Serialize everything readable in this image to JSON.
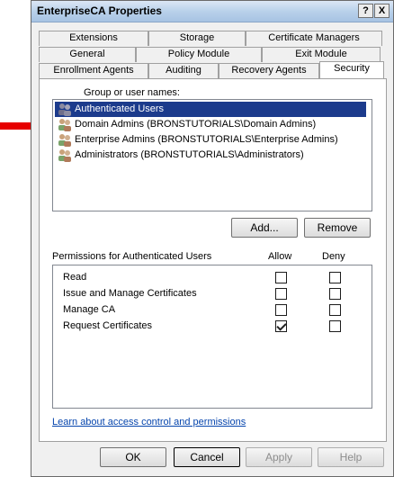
{
  "window": {
    "title": "EnterpriseCA Properties",
    "help_glyph": "?",
    "close_glyph": "X"
  },
  "tabs": {
    "row1": [
      "Extensions",
      "Storage",
      "Certificate Managers"
    ],
    "row2": [
      "General",
      "Policy Module",
      "Exit Module"
    ],
    "row3": [
      "Enrollment Agents",
      "Auditing",
      "Recovery Agents",
      "Security"
    ],
    "active": "Security"
  },
  "security": {
    "group_label": "Group or user names:",
    "users": [
      {
        "name": "Authenticated Users",
        "icon": "users-icon",
        "selected": true
      },
      {
        "name": "Domain Admins (BRONSTUTORIALS\\Domain Admins)",
        "icon": "users-icon",
        "selected": false
      },
      {
        "name": "Enterprise Admins (BRONSTUTORIALS\\Enterprise Admins)",
        "icon": "users-icon",
        "selected": false
      },
      {
        "name": "Administrators (BRONSTUTORIALS\\Administrators)",
        "icon": "users-icon",
        "selected": false
      }
    ],
    "add_label": "Add...",
    "remove_label": "Remove",
    "permissions_label": "Permissions for Authenticated Users",
    "allow_label": "Allow",
    "deny_label": "Deny",
    "permissions": [
      {
        "name": "Read",
        "allow": false,
        "deny": false
      },
      {
        "name": "Issue and Manage Certificates",
        "allow": false,
        "deny": false
      },
      {
        "name": "Manage CA",
        "allow": false,
        "deny": false
      },
      {
        "name": "Request Certificates",
        "allow": true,
        "deny": false
      }
    ],
    "link_text": "Learn about access control and permissions"
  },
  "footer": {
    "ok_label": "OK",
    "cancel_label": "Cancel",
    "apply_label": "Apply",
    "help_label": "Help"
  },
  "annotation": {
    "arrow_color": "#e60000"
  }
}
